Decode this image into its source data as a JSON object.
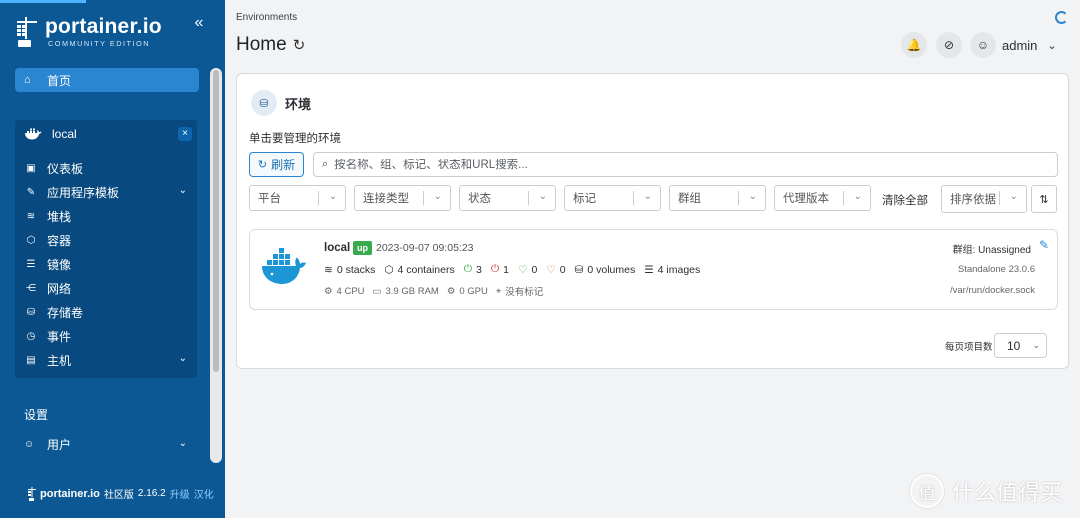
{
  "sidebar": {
    "logo": {
      "main": "portainer.io",
      "sub": "COMMUNITY EDITION"
    },
    "collapse_icon": "«",
    "home": {
      "icon": "home-icon",
      "label": "首页"
    },
    "environment": {
      "name": "local",
      "close_icon": "×",
      "items": [
        {
          "icon": "dashboard-icon",
          "label": "仪表板",
          "expandable": false
        },
        {
          "icon": "templates-icon",
          "label": "应用程序模板",
          "expandable": true
        },
        {
          "icon": "stacks-icon",
          "label": "堆栈",
          "expandable": false
        },
        {
          "icon": "containers-icon",
          "label": "容器",
          "expandable": false
        },
        {
          "icon": "images-icon",
          "label": "镜像",
          "expandable": false
        },
        {
          "icon": "networks-icon",
          "label": "网络",
          "expandable": false
        },
        {
          "icon": "volumes-icon",
          "label": "存储卷",
          "expandable": false
        },
        {
          "icon": "events-icon",
          "label": "事件",
          "expandable": false
        },
        {
          "icon": "host-icon",
          "label": "主机",
          "expandable": true
        }
      ]
    },
    "settings_label": "设置",
    "users": {
      "icon": "user-icon",
      "label": "用户"
    },
    "footer": {
      "brand": "portainer.io",
      "edition": "社区版",
      "version": "2.16.2",
      "upgrade": "升级",
      "localize": "汉化"
    }
  },
  "header": {
    "breadcrumb": "Environments",
    "title": "Home",
    "username": "admin"
  },
  "card": {
    "title": "环境",
    "subtitle": "单击要管理的环境",
    "refresh_label": "刷新",
    "search_placeholder": "按名称、组、标记、状态和URL搜索...",
    "filters": [
      "平台",
      "连接类型",
      "状态",
      "标记",
      "群组",
      "代理版本"
    ],
    "clear_all": "清除全部",
    "sort_placeholder": "排序依据",
    "environment": {
      "name": "local",
      "status": "up",
      "timestamp": "2023-09-07 09:05:23",
      "stacks": "0 stacks",
      "containers": "4 containers",
      "running": "3",
      "stopped": "1",
      "healthy": "0",
      "unhealthy": "0",
      "volumes": "0 volumes",
      "images": "4 images",
      "cpu": "4 CPU",
      "ram": "3.9 GB RAM",
      "gpu": "0 GPU",
      "tags": "没有标记",
      "group": "群组: Unassigned",
      "type": "Standalone 23.0.6",
      "url": "/var/run/docker.sock"
    },
    "per_page_label": "每页项目数",
    "per_page_value": "10"
  },
  "watermark": {
    "text": "什么值得买",
    "mark": "值"
  },
  "colors": {
    "sidebar": "#0b5895",
    "accent": "#2a86d0",
    "status_up": "#3aaa4f"
  }
}
